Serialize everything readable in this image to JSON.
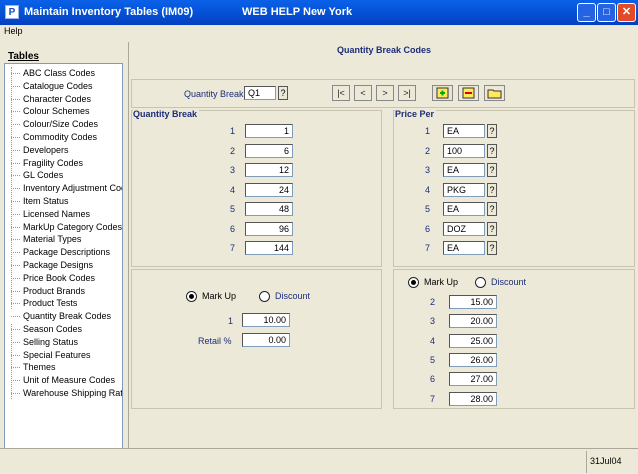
{
  "window": {
    "title": "Maintain Inventory Tables (IM09)",
    "web_help": "WEB HELP",
    "location": "New York",
    "app_icon": "P"
  },
  "menu": {
    "help": "Help"
  },
  "sidebar": {
    "heading": "Tables",
    "items": [
      "ABC Class Codes",
      "Catalogue Codes",
      "Character Codes",
      "Colour Schemes",
      "Colour/Size Codes",
      "Commodity Codes",
      "Developers",
      "Fragility Codes",
      "GL Codes",
      "Inventory Adjustment Cod",
      "Item Status",
      "Licensed Names",
      "MarkUp Category Codes",
      "Material Types",
      "Package Descriptions",
      "Package Designs",
      "Price Book Codes",
      "Product Brands",
      "Product Tests",
      "Quantity Break Codes",
      "Season Codes",
      "Selling Status",
      "Special Features",
      "Themes",
      "Unit of Measure Codes",
      "Warehouse Shipping Rat"
    ],
    "selected": "Quantity Break Codes"
  },
  "main": {
    "title": "Quantity Break Codes",
    "qb_label": "Quantity Break",
    "qb_value": "Q1",
    "lookup": "?",
    "nav": [
      "|<",
      "<",
      ">",
      ">|"
    ],
    "qty_group_title": "Quantity Break",
    "price_group_title": "Price Per",
    "rows": [
      "1",
      "2",
      "3",
      "4",
      "5",
      "6",
      "7"
    ],
    "quantities": [
      "1",
      "6",
      "12",
      "24",
      "48",
      "96",
      "144"
    ],
    "price_per": [
      "EA",
      "100",
      "EA",
      "PKG",
      "EA",
      "DOZ",
      "EA"
    ],
    "left_markup": {
      "mark_up": "Mark Up",
      "discount": "Discount",
      "row_label": "1",
      "value": "10.00",
      "retail_label": "Retail %",
      "retail_value": "0.00"
    },
    "right_markup": {
      "mark_up": "Mark Up",
      "discount": "Discount",
      "rows": [
        "2",
        "3",
        "4",
        "5",
        "6",
        "7"
      ],
      "values": [
        "15.00",
        "20.00",
        "25.00",
        "26.00",
        "27.00",
        "28.00"
      ]
    }
  },
  "status": {
    "date": "31Jul04"
  }
}
